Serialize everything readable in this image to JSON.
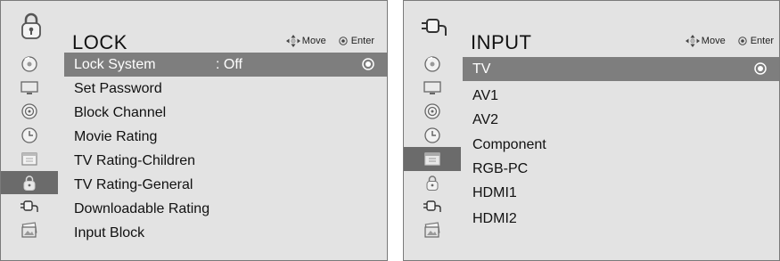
{
  "lock_panel": {
    "title": "LOCK",
    "icon": "padlock-icon",
    "nav_hint": {
      "move": "Move",
      "enter": "Enter"
    },
    "side_icons": [
      "disc-icon",
      "monitor-icon",
      "speaker-icon",
      "clock-icon",
      "calendar-icon",
      "padlock-icon",
      "plug-icon",
      "photo-icon"
    ],
    "selected_side_icon": "padlock-icon",
    "items": [
      {
        "label": "Lock System",
        "value": ": Off",
        "selected": true
      },
      {
        "label": "Set Password"
      },
      {
        "label": "Block Channel"
      },
      {
        "label": "Movie Rating"
      },
      {
        "label": "TV Rating-Children"
      },
      {
        "label": "TV Rating-General"
      },
      {
        "label": "Downloadable Rating"
      },
      {
        "label": "Input Block"
      }
    ]
  },
  "input_panel": {
    "title": "INPUT",
    "icon": "plug-icon",
    "nav_hint": {
      "move": "Move",
      "enter": "Enter"
    },
    "side_icons": [
      "disc-icon",
      "monitor-icon",
      "speaker-icon",
      "clock-icon",
      "calendar-icon",
      "padlock-icon",
      "plug-icon",
      "photo-icon"
    ],
    "selected_side_icon": "calendar-icon",
    "items": [
      {
        "label": "TV",
        "selected": true
      },
      {
        "label": "AV1"
      },
      {
        "label": "AV2"
      },
      {
        "label": "Component"
      },
      {
        "label": "RGB-PC"
      },
      {
        "label": "HDMI1"
      },
      {
        "label": "HDMI2"
      }
    ]
  }
}
